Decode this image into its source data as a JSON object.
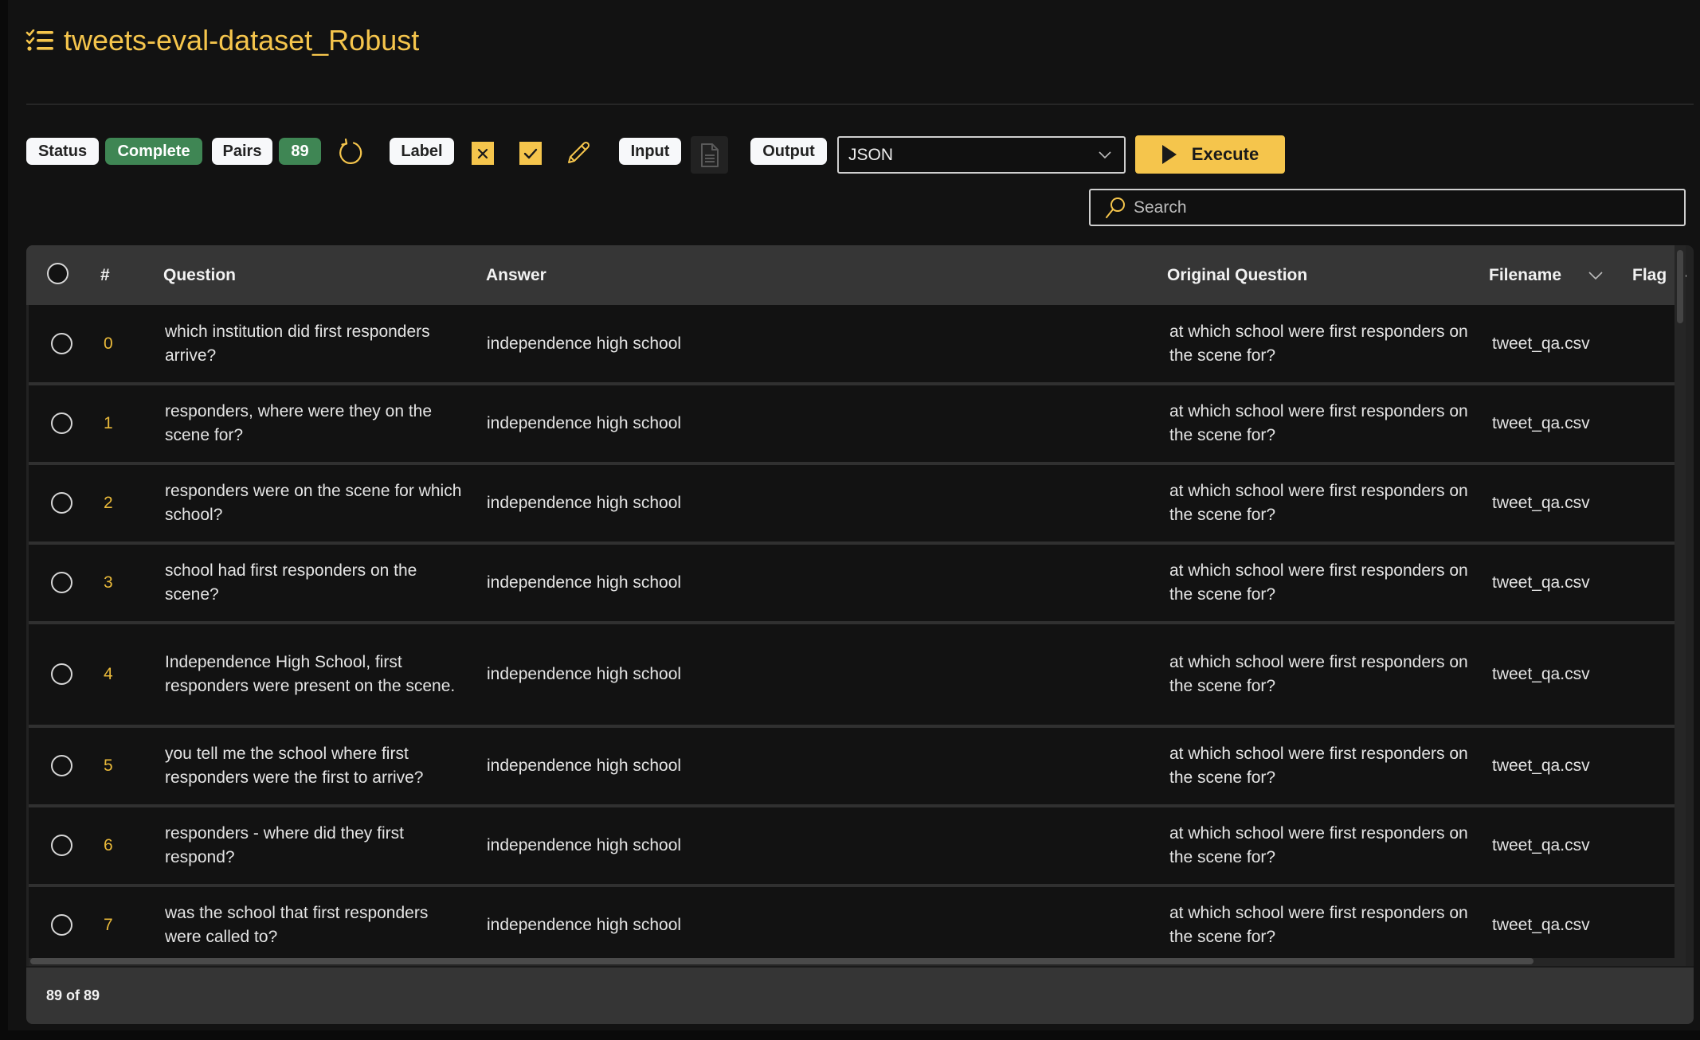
{
  "header": {
    "title": "tweets-eval-dataset_Robust",
    "icon": "list-check-icon"
  },
  "toolbar": {
    "status_label": "Status",
    "status_value": "Complete",
    "pairs_label": "Pairs",
    "pairs_value": "89",
    "refresh_icon": "refresh-icon",
    "label_label": "Label",
    "reject_icon": "x-icon",
    "accept_icon": "check-icon",
    "edit_icon": "pencil-icon",
    "input_label": "Input",
    "input_file_icon": "document-icon",
    "output_label": "Output",
    "output_format": "JSON",
    "execute_label": "Execute",
    "search_placeholder": "Search",
    "search_value": ""
  },
  "colors": {
    "accent": "#f5c54c",
    "success": "#3f8654",
    "background": "#121212",
    "header_row": "#363636"
  },
  "table": {
    "columns": [
      "#",
      "Question",
      "Answer",
      "Original Question",
      "Filename",
      "Flag"
    ],
    "rows": [
      {
        "index": "0",
        "question": "which institution did first responders arrive?",
        "answer": "independence high school",
        "original_question": "at which school were first responders on the scene for?",
        "filename": "tweet_qa.csv",
        "flag": ""
      },
      {
        "index": "1",
        "question": "responders, where were they on the scene for?",
        "answer": "independence high school",
        "original_question": "at which school were first responders on the scene for?",
        "filename": "tweet_qa.csv",
        "flag": ""
      },
      {
        "index": "2",
        "question": "responders were on the scene for which school?",
        "answer": "independence high school",
        "original_question": "at which school were first responders on the scene for?",
        "filename": "tweet_qa.csv",
        "flag": ""
      },
      {
        "index": "3",
        "question": "school had first responders on the scene?",
        "answer": "independence high school",
        "original_question": "at which school were first responders on the scene for?",
        "filename": "tweet_qa.csv",
        "flag": ""
      },
      {
        "index": "4",
        "question": "Independence High School, first responders were present on the scene.",
        "answer": "independence high school",
        "original_question": "at which school were first responders on the scene for?",
        "filename": "tweet_qa.csv",
        "flag": ""
      },
      {
        "index": "5",
        "question": "you tell me the school where first responders were the first to arrive?",
        "answer": "independence high school",
        "original_question": "at which school were first responders on the scene for?",
        "filename": "tweet_qa.csv",
        "flag": ""
      },
      {
        "index": "6",
        "question": "responders - where did they first respond?",
        "answer": "independence high school",
        "original_question": "at which school were first responders on the scene for?",
        "filename": "tweet_qa.csv",
        "flag": ""
      },
      {
        "index": "7",
        "question": "was the school that first responders were called to?",
        "answer": "independence high school",
        "original_question": "at which school were first responders on the scene for?",
        "filename": "tweet_qa.csv",
        "flag": ""
      }
    ]
  },
  "footer": {
    "count_text": "89 of 89"
  }
}
